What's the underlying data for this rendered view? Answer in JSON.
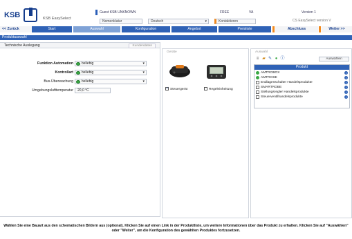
{
  "header": {
    "logo_text": "KSB",
    "app_name": "KSB EasySelect",
    "status_guest": "Guest KSB UNKNOWN",
    "status_code": "FREE",
    "status_flag": "VA",
    "status_version": "Version 1",
    "nomenclature_placeholder": "Nomenklatur",
    "language_value": "Deutsch",
    "contact_label": "Kontaktieren",
    "version_info": "CS EasySelect version V"
  },
  "nav": {
    "back_label": "<< Zurück",
    "items": [
      "Start",
      "Auswahl",
      "Konfiguration",
      "Angebot",
      "Preisliste"
    ],
    "finish_label": "Abschluss",
    "next_label": "Weiter >>"
  },
  "section": {
    "title": "Produktauswahl"
  },
  "left_panel": {
    "tab_label": "Technische Auslegung",
    "tab_extra": "Kundendaten"
  },
  "form": {
    "rows": [
      {
        "label": "Funktion Automation",
        "value": "beliebig"
      },
      {
        "label": "Kontrollart",
        "value": "beliebig"
      },
      {
        "label": "Bus-Überwachung",
        "value": "beliebig"
      },
      {
        "label": "Umgebungslufttemperatur",
        "value": "20,0 °C"
      }
    ]
  },
  "mid_panel": {
    "title": "Geräte",
    "device_1_label": "Steuergerät",
    "device_2_label": "Regeleinheitung"
  },
  "right_panel": {
    "title": "Auswahl",
    "select_label": "Auswählen",
    "list_header": "Produkt",
    "items": [
      "AMTROBOX",
      "AMTROSE",
      "Endlagenschalter Handelsprodukte",
      "SMARTROBE",
      "Stellungsregler Handelsprodukte",
      "Steuerventilhandelsprodukte"
    ]
  },
  "footer": {
    "text": "Wählen Sie eine Bauart aus den schematischen Bildern aus (optional). Klicken Sie auf einen Link in der Produktliste, um weitere Informationen über das Produkt zu erhalten. Klicken Sie auf \"Auswählen\" oder \"Weiter\", um die Konfiguration des gewählten Produktes fortzusetzen."
  },
  "colors": {
    "brand": "#143c8c",
    "nav_blue": "#2f62b6",
    "accent_orange": "#f28a1e",
    "ok_green": "#3aa845"
  }
}
